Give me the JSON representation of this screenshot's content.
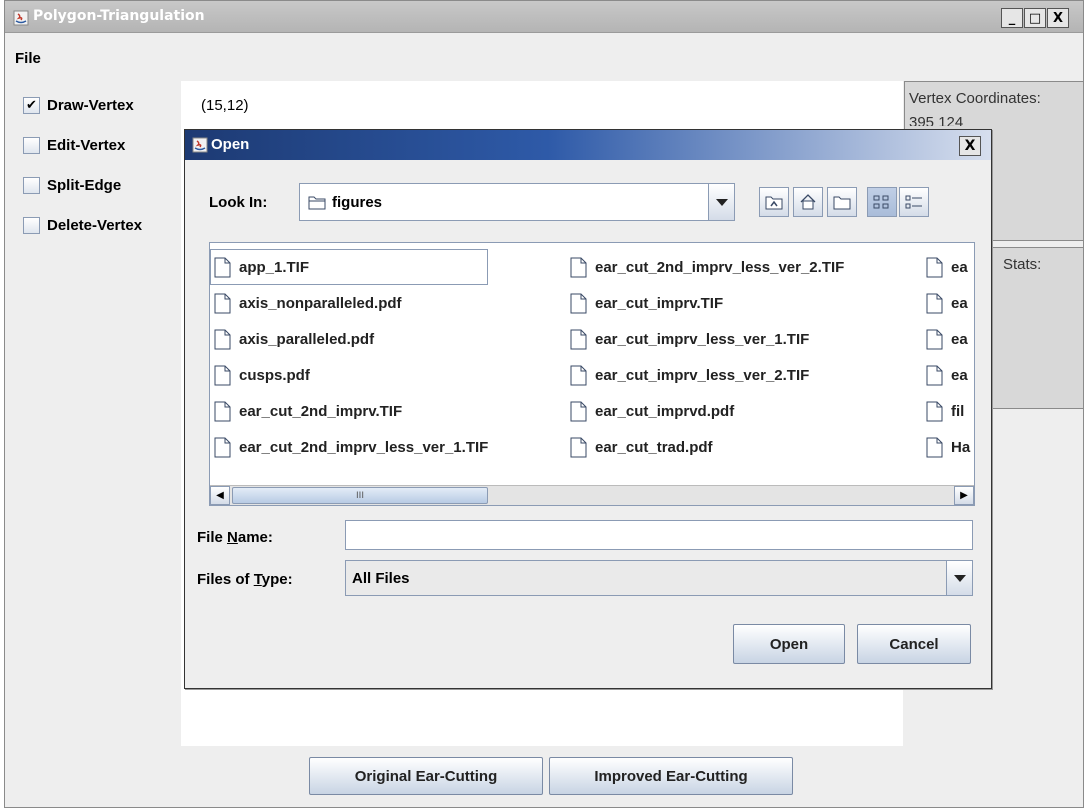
{
  "window": {
    "title": "Polygon-Triangulation",
    "minimize": "_",
    "maximize": "□",
    "close": "X"
  },
  "menu": {
    "file": "File"
  },
  "modes": [
    {
      "label": "Draw-Vertex",
      "checked": true
    },
    {
      "label": "Edit-Vertex",
      "checked": false
    },
    {
      "label": "Split-Edge",
      "checked": false
    },
    {
      "label": "Delete-Vertex",
      "checked": false
    }
  ],
  "canvas": {
    "coordinate": "(15,12)"
  },
  "right_panel": {
    "vertex_title": "Vertex Coordinates:",
    "vertex_first": "395 124",
    "stats_title": "Stats:"
  },
  "buttons": {
    "original": "Original Ear-Cutting",
    "improved": "Improved Ear-Cutting"
  },
  "dialog": {
    "title": "Open",
    "close": "X",
    "look_in_label": "Look In:",
    "look_in_value": "figures",
    "file_name_label": "File Name:",
    "file_name_value": "",
    "files_of_type_label": "Files of Type:",
    "files_of_type_value": "All Files",
    "open_button": "Open",
    "cancel_button": "Cancel",
    "scroll_grip": "III",
    "columns": [
      [
        "app_1.TIF",
        "axis_nonparalleled.pdf",
        "axis_paralleled.pdf",
        "cusps.pdf",
        "ear_cut_2nd_imprv.TIF",
        "ear_cut_2nd_imprv_less_ver_1.TIF"
      ],
      [
        "ear_cut_2nd_imprv_less_ver_2.TIF",
        "ear_cut_imprv.TIF",
        "ear_cut_imprv_less_ver_1.TIF",
        "ear_cut_imprv_less_ver_2.TIF",
        "ear_cut_imprvd.pdf",
        "ear_cut_trad.pdf"
      ],
      [
        "ea",
        "ea",
        "ea",
        "ea",
        "fil",
        "Ha"
      ]
    ],
    "selected_file": "app_1.TIF"
  }
}
